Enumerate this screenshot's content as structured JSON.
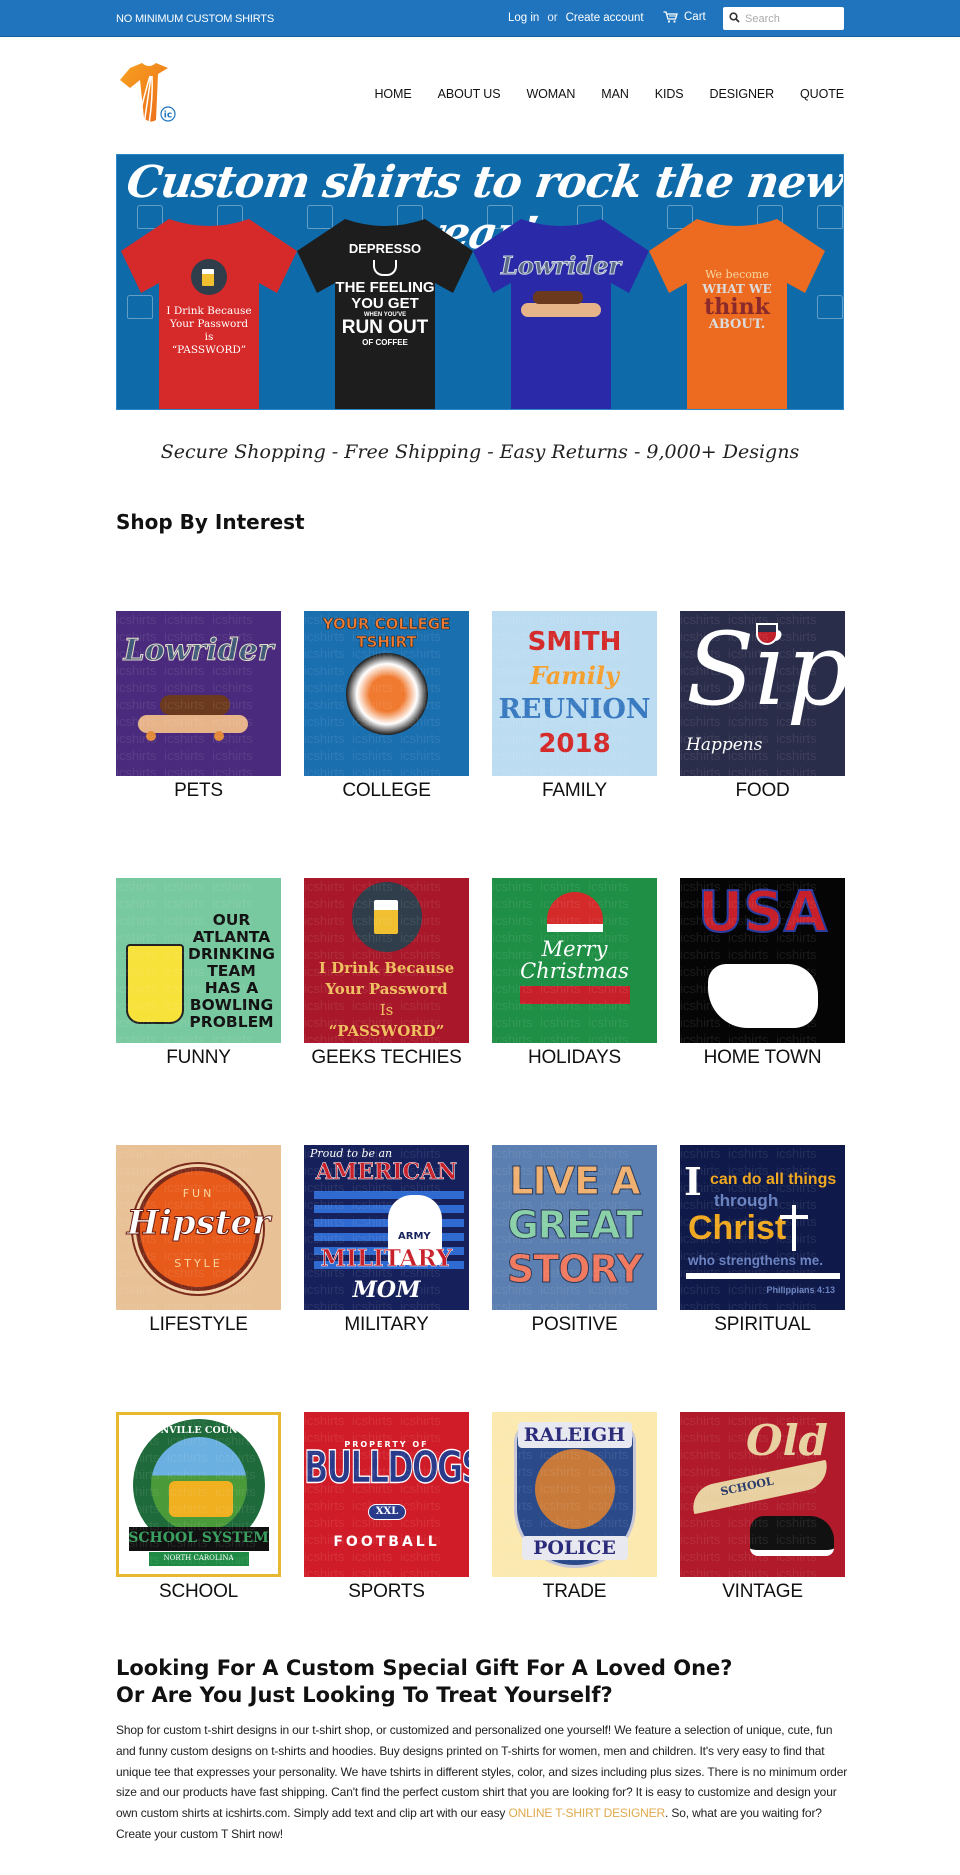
{
  "topbar": {
    "promo": "NO MINIMUM CUSTOM SHIRTS",
    "login": "Log in",
    "or": "or",
    "create_account": "Create account",
    "cart": "Cart",
    "search_placeholder": "Search"
  },
  "header": {
    "logo_badge": "ic",
    "nav": [
      "HOME",
      "ABOUT US",
      "WOMAN",
      "MAN",
      "KIDS",
      "DESIGNER",
      "QUOTE"
    ]
  },
  "hero": {
    "title": "Custom shirts to rock the new year!",
    "shirts": [
      {
        "color": "#d62a2a",
        "lines": [
          "I Drink Because",
          "Your Password",
          "is",
          "“PASSWORD”"
        ]
      },
      {
        "color": "#1d1d1d",
        "lines": [
          "DEPRESSO",
          "THE FEELING",
          "YOU GET",
          "WHEN YOU'VE",
          "RUN OUT",
          "OF COFFEE"
        ]
      },
      {
        "color": "#2a2aa8",
        "lines": [
          "Lowrider"
        ]
      },
      {
        "color": "#ec6b20",
        "lines": [
          "We become",
          "WHAT WE",
          "think",
          "ABOUT."
        ]
      }
    ]
  },
  "tagline": "Secure Shopping - Free Shipping - Easy Returns - 9,000+ Designs",
  "shop_by_interest": {
    "title": "Shop By Interest",
    "watermark": "icshirts",
    "categories": [
      {
        "label": "PETS",
        "bg": "#4a2a7c",
        "art": [
          "Lowrider"
        ]
      },
      {
        "label": "COLLEGE",
        "bg": "#1a6faf",
        "art": [
          "YOUR COLLEGE TSHIRT"
        ]
      },
      {
        "label": "FAMILY",
        "bg": "#bcdcf2",
        "art": [
          "SMITH",
          "Family",
          "REUNION",
          "2018"
        ]
      },
      {
        "label": "FOOD",
        "bg": "#2a2d4a",
        "art": [
          "Sip",
          "Happens"
        ]
      },
      {
        "label": "FUNNY",
        "bg": "#78c9a0",
        "art": [
          "OUR",
          "ATLANTA",
          "DRINKING",
          "TEAM",
          "HAS A",
          "BOWLING",
          "PROBLEM"
        ]
      },
      {
        "label": "GEEKS TECHIES",
        "bg": "#a8182a",
        "art": [
          "I Drink Because",
          "Your Password",
          "Is",
          "“PASSWORD”"
        ]
      },
      {
        "label": "HOLIDAYS",
        "bg": "#1e8f44",
        "art": [
          "Merry",
          "Christmas"
        ]
      },
      {
        "label": "HOME TOWN",
        "bg": "#050505",
        "art": [
          "USA"
        ]
      },
      {
        "label": "LIFESTYLE",
        "bg": "#e8c196",
        "art": [
          "FUN",
          "Hipster",
          "STYLE"
        ]
      },
      {
        "label": "MILITARY",
        "bg": "#16205a",
        "art": [
          "Proud to be an",
          "AMERICAN",
          "ARMY",
          "MILITARY",
          "MOM"
        ]
      },
      {
        "label": "POSITIVE",
        "bg": "#5b7fb0",
        "art": [
          "LIVE A",
          "GREAT",
          "STORY"
        ]
      },
      {
        "label": "SPIRITUAL",
        "bg": "#0f1a4a",
        "art": [
          "I",
          "can do all things",
          "through",
          "Christ",
          "who strengthens me.",
          "Philippians 4:13"
        ]
      },
      {
        "label": "SCHOOL",
        "bg": "#ffffff",
        "art": [
          "FUNVILLE COUNTY",
          "SCHOOL SYSTEM",
          "NORTH CAROLINA"
        ]
      },
      {
        "label": "SPORTS",
        "bg": "#d01c28",
        "art": [
          "PROPERTY OF",
          "BULLDOGS",
          "XXL",
          "FOOTBALL"
        ]
      },
      {
        "label": "TRADE",
        "bg": "#fbe9b0",
        "art": [
          "RALEIGH",
          "POLICE"
        ]
      },
      {
        "label": "VINTAGE",
        "bg": "#b01a2a",
        "art": [
          "Old",
          "SCHOOL"
        ]
      }
    ]
  },
  "gift_section": {
    "heading_line1": "Looking For A Custom Special Gift For A Loved One?",
    "heading_line2": "Or Are You Just Looking To Treat Yourself?",
    "paragraph_before_link": "Shop for custom t-shirt designs in our t-shirt shop, or customized and personalized one yourself! We feature a selection of unique, cute, fun and funny custom designs on t-shirts and hoodies. Buy designs printed on T-shirts for women, men and children. It's very easy to find that unique tee that expresses your personality. We have tshirts in different styles, color, and sizes including plus sizes. There is no minimum order size and our products have fast shipping. Can't find the perfect custom shirt that you are looking for? It is easy to customize and design your own custom shirts at icshirts.com. Simply add text and clip art with our easy ",
    "link_text": "ONLINE T-SHIRT DESIGNER",
    "paragraph_after_link": ". So, what are you waiting for? Create your custom T Shirt now!",
    "link_color": "#e0a94c"
  },
  "colors": {
    "topbar": "#1f74bd",
    "hero_bg": "#0e6aa8",
    "logo_orange": "#f08a1c"
  }
}
